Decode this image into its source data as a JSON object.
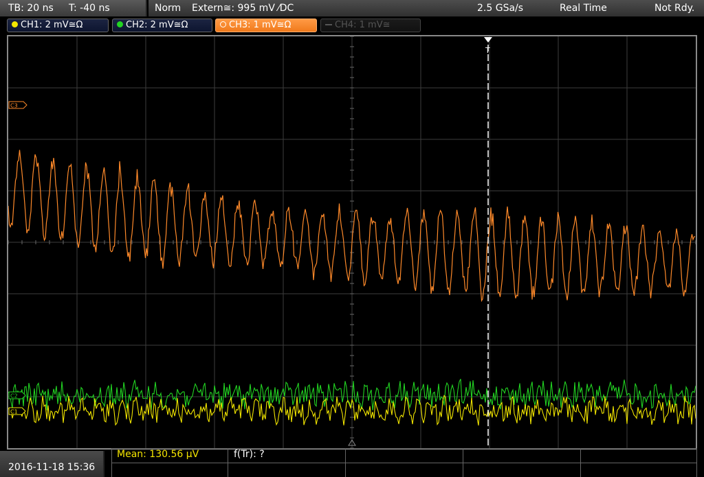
{
  "topbar": {
    "timebase": "TB: 20 ns",
    "trigger_offset": "T: -40 ns",
    "mode": "Norm",
    "trigger_source": "Extern≅: 995 mV ⁄DC",
    "sample_rate": "2.5 GSa/s",
    "acq_mode": "Real Time",
    "status": "Not Rdy."
  },
  "channels": [
    {
      "label": "CH1: 2 mV≅Ω",
      "color": "#f2e600",
      "active": true
    },
    {
      "label": "CH2: 2 mV≅Ω",
      "color": "#22d422",
      "active": true
    },
    {
      "label": "CH3: 1 mV≅Ω",
      "color": "#ff8a2a",
      "active": true,
      "selected": true
    },
    {
      "label": "CH4: 1 mV≅",
      "color": "#555555",
      "active": false
    }
  ],
  "screen": {
    "c3_marker": "C3",
    "trigger_marker": "T",
    "ch1_marker": "C1",
    "ch2_marker": "C2"
  },
  "bottom": {
    "datetime": "2016-11-18 15:36",
    "measurement_mean": "Mean: 130.56 µV",
    "measurement_ftr": "f(Tr): ?"
  },
  "colors": {
    "ch1": "#f2e600",
    "ch2": "#22d422",
    "ch3": "#ff8a2a",
    "grid": "#4a4a4a",
    "trigger_line": "#ffffff"
  }
}
